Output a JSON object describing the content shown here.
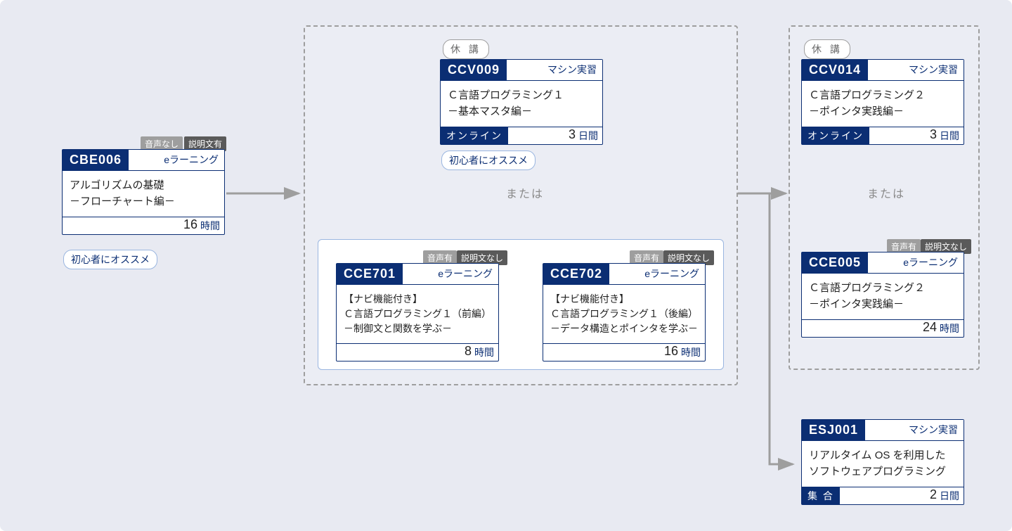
{
  "labels": {
    "or": "または",
    "cancel": "休 講",
    "recommended": "初心者にオススメ",
    "audio_none": "音声なし",
    "audio_has": "音声有",
    "text_has": "説明文有",
    "text_none": "説明文なし"
  },
  "cards": {
    "cbe006": {
      "code": "CBE006",
      "type": "eラーニング",
      "title": "アルゴリズムの基礎\n－フローチャート編－",
      "num": "16",
      "unit": "時間"
    },
    "ccv009": {
      "code": "CCV009",
      "type": "マシン実習",
      "title": "Ｃ言語プログラミング１\n－基本マスタ編－",
      "mode": "オンライン",
      "num": "3",
      "unit": "日間"
    },
    "cce701": {
      "code": "CCE701",
      "type": "eラーニング",
      "title": "【ナビ機能付き】\nＣ言語プログラミング１（前編）\n－制御文と関数を学ぶ－",
      "num": "8",
      "unit": "時間"
    },
    "cce702": {
      "code": "CCE702",
      "type": "eラーニング",
      "title": "【ナビ機能付き】\nＣ言語プログラミング１（後編）\n－データ構造とポインタを学ぶ－",
      "num": "16",
      "unit": "時間"
    },
    "ccv014": {
      "code": "CCV014",
      "type": "マシン実習",
      "title": "Ｃ言語プログラミング２\n－ポインタ実践編－",
      "mode": "オンライン",
      "num": "3",
      "unit": "日間"
    },
    "cce005": {
      "code": "CCE005",
      "type": "eラーニング",
      "title": "Ｃ言語プログラミング２\n－ポインタ実践編－",
      "num": "24",
      "unit": "時間"
    },
    "esj001": {
      "code": "ESJ001",
      "type": "マシン実習",
      "title": "リアルタイム OS を利用した\nソフトウェアプログラミング",
      "mode": "集 合",
      "num": "2",
      "unit": "日間"
    }
  }
}
